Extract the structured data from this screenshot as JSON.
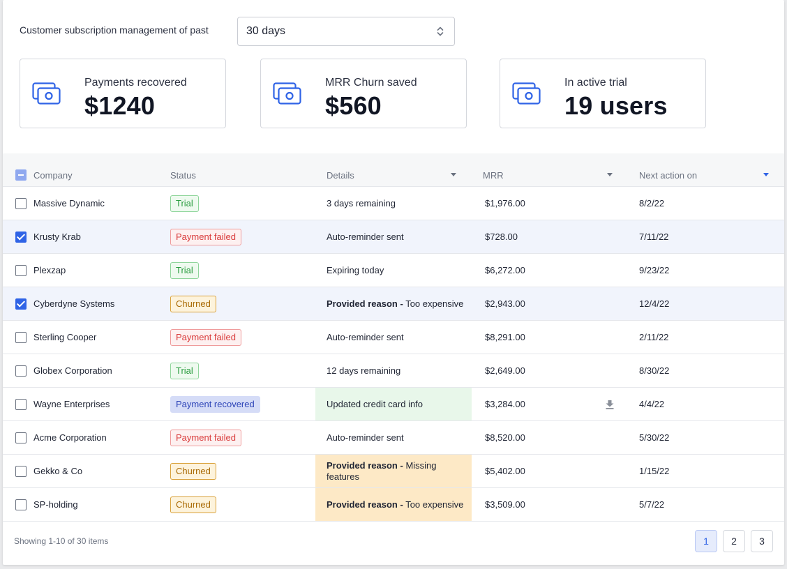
{
  "filter": {
    "label": "Customer subscription management of past",
    "period": "30 days"
  },
  "cards": [
    {
      "label": "Payments recovered",
      "value": "$1240",
      "icon": "money-icon"
    },
    {
      "label": "MRR Churn saved",
      "value": "$560",
      "icon": "money-icon"
    },
    {
      "label": "In active trial",
      "value": "19 users",
      "icon": "money-icon"
    }
  ],
  "table": {
    "columns": {
      "company": "Company",
      "status": "Status",
      "details": "Details",
      "mrr": "MRR",
      "next": "Next action on"
    },
    "rows": [
      {
        "company": "Massive Dynamic",
        "status": "Trial",
        "details_bold": "",
        "details": "3 days remaining",
        "mrr": "$1,976.00",
        "next": "8/2/22",
        "checked": false
      },
      {
        "company": "Krusty Krab",
        "status": "Payment failed",
        "details_bold": "",
        "details": "Auto-reminder sent",
        "mrr": "$728.00",
        "next": "7/11/22",
        "checked": true
      },
      {
        "company": "Plexzap",
        "status": "Trial",
        "details_bold": "",
        "details": "Expiring today",
        "mrr": "$6,272.00",
        "next": "9/23/22",
        "checked": false
      },
      {
        "company": "Cyberdyne Systems",
        "status": "Churned",
        "details_bold": "Provided reason -",
        "details": "Too expensive",
        "mrr": "$2,943.00",
        "next": "12/4/22",
        "checked": true
      },
      {
        "company": "Sterling Cooper",
        "status": "Payment failed",
        "details_bold": "",
        "details": "Auto-reminder sent",
        "mrr": "$8,291.00",
        "next": "2/11/22",
        "checked": false
      },
      {
        "company": "Globex Corporation",
        "status": "Trial",
        "details_bold": "",
        "details": "12 days remaining",
        "mrr": "$2,649.00",
        "next": "8/30/22",
        "checked": false
      },
      {
        "company": "Wayne Enterprises",
        "status": "Payment recovered",
        "details_bold": "",
        "details": "Updated credit card info",
        "mrr": "$3,284.00",
        "next": "4/4/22",
        "checked": false
      },
      {
        "company": "Acme Corporation",
        "status": "Payment failed",
        "details_bold": "",
        "details": "Auto-reminder sent",
        "mrr": "$8,520.00",
        "next": "5/30/22",
        "checked": false
      },
      {
        "company": "Gekko & Co",
        "status": "Churned",
        "details_bold": "Provided reason -",
        "details": "Missing features",
        "mrr": "$5,402.00",
        "next": "1/15/22",
        "checked": false
      },
      {
        "company": "SP-holding",
        "status": "Churned",
        "details_bold": "Provided reason -",
        "details": "Too expensive",
        "mrr": "$3,509.00",
        "next": "5/7/22",
        "checked": false
      }
    ]
  },
  "footer": {
    "showing": "Showing 1-10 of 30 items",
    "pages": [
      "1",
      "2",
      "3"
    ],
    "current_page": "1"
  }
}
